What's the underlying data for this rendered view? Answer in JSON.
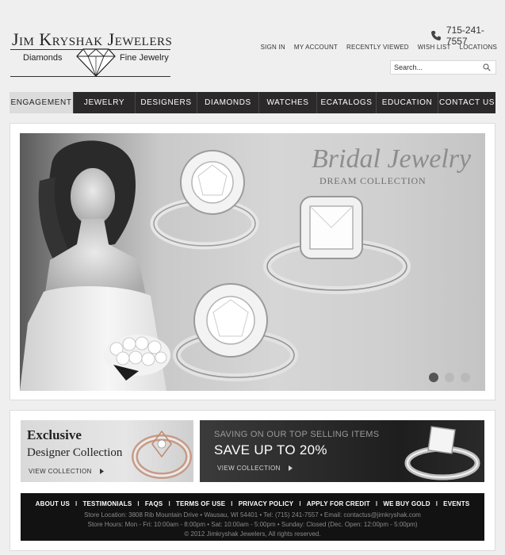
{
  "header": {
    "logo": {
      "title": "Jim Kryshak Jewelers",
      "left": "Diamonds",
      "right": "Fine Jewelry"
    },
    "phone": "715-241-7557",
    "links": [
      "SIGN IN",
      "MY ACCOUNT",
      "RECENTLY VIEWED",
      "WISH LIST",
      "LOCATIONS"
    ],
    "search_placeholder": "Search..."
  },
  "nav": {
    "items": [
      "ENGAGEMENT",
      "JEWELRY",
      "DESIGNERS",
      "DIAMONDS",
      "WATCHES",
      "ECATALOGS",
      "EDUCATION",
      "CONTACT US"
    ],
    "active": "ENGAGEMENT"
  },
  "hero": {
    "title": "Bridal Jewelry",
    "subtitle": "DREAM COLLECTION",
    "dot_count": 3,
    "active_dot": 1
  },
  "promos": {
    "left": {
      "title": "Exclusive",
      "subtitle": "Designer Collection",
      "link": "VIEW COLLECTION"
    },
    "right": {
      "top": "SAVING ON OUR TOP SELLING ITEMS",
      "main": "SAVE UP TO 20%",
      "link": "VIEW COLLECTION"
    }
  },
  "footer": {
    "links": [
      "ABOUT US",
      "TESTIMONIALS",
      "FAQS",
      "TERMS OF USE",
      "PRIVACY POLICY",
      "APPLY FOR CREDIT",
      "WE BUY GOLD",
      "EVENTS"
    ],
    "location": "Store Location: 3808 Rib Mountain Drive • Wausau,  WI  54401 • Tel: (715) 241-7557 • Email: contactus@jimkryshak.com",
    "hours": "Store Hours: Mon - Fri: 10:00am - 8:00pm • Sat: 10:00am - 5:00pm • Sunday: Closed (Dec. Open: 12:00pm - 5:00pm)",
    "copyright": "© 2012 Jimkryshak Jewelers, All rights reserved."
  },
  "colors": {
    "nav_bg": "#2b2929",
    "nav_active_bg": "#dcdcdc",
    "footer_bg": "#121212",
    "page_bg": "#efefef"
  },
  "icons": [
    "phone-icon",
    "search-icon",
    "diamond-logo-icon",
    "chevron-right-icon"
  ]
}
